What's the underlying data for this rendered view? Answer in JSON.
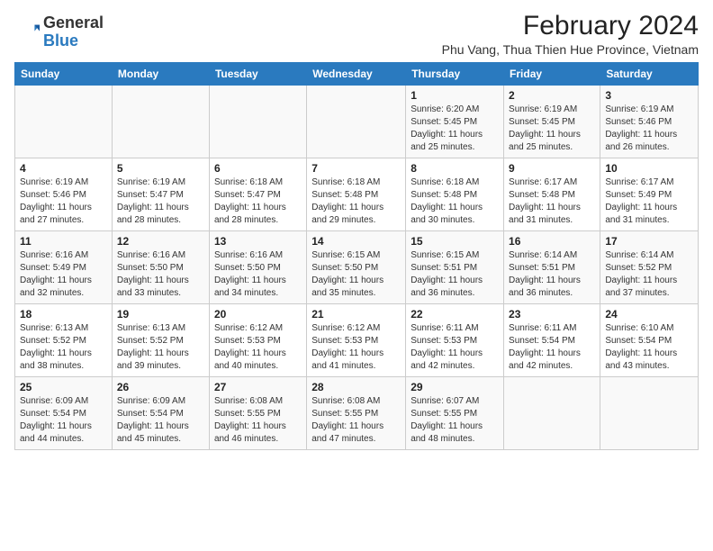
{
  "logo": {
    "general": "General",
    "blue": "Blue"
  },
  "title": "February 2024",
  "subtitle": "Phu Vang, Thua Thien Hue Province, Vietnam",
  "headers": [
    "Sunday",
    "Monday",
    "Tuesday",
    "Wednesday",
    "Thursday",
    "Friday",
    "Saturday"
  ],
  "weeks": [
    [
      {
        "date": "",
        "info": ""
      },
      {
        "date": "",
        "info": ""
      },
      {
        "date": "",
        "info": ""
      },
      {
        "date": "",
        "info": ""
      },
      {
        "date": "1",
        "info": "Sunrise: 6:20 AM\nSunset: 5:45 PM\nDaylight: 11 hours and 25 minutes."
      },
      {
        "date": "2",
        "info": "Sunrise: 6:19 AM\nSunset: 5:45 PM\nDaylight: 11 hours and 25 minutes."
      },
      {
        "date": "3",
        "info": "Sunrise: 6:19 AM\nSunset: 5:46 PM\nDaylight: 11 hours and 26 minutes."
      }
    ],
    [
      {
        "date": "4",
        "info": "Sunrise: 6:19 AM\nSunset: 5:46 PM\nDaylight: 11 hours and 27 minutes."
      },
      {
        "date": "5",
        "info": "Sunrise: 6:19 AM\nSunset: 5:47 PM\nDaylight: 11 hours and 28 minutes."
      },
      {
        "date": "6",
        "info": "Sunrise: 6:18 AM\nSunset: 5:47 PM\nDaylight: 11 hours and 28 minutes."
      },
      {
        "date": "7",
        "info": "Sunrise: 6:18 AM\nSunset: 5:48 PM\nDaylight: 11 hours and 29 minutes."
      },
      {
        "date": "8",
        "info": "Sunrise: 6:18 AM\nSunset: 5:48 PM\nDaylight: 11 hours and 30 minutes."
      },
      {
        "date": "9",
        "info": "Sunrise: 6:17 AM\nSunset: 5:48 PM\nDaylight: 11 hours and 31 minutes."
      },
      {
        "date": "10",
        "info": "Sunrise: 6:17 AM\nSunset: 5:49 PM\nDaylight: 11 hours and 31 minutes."
      }
    ],
    [
      {
        "date": "11",
        "info": "Sunrise: 6:16 AM\nSunset: 5:49 PM\nDaylight: 11 hours and 32 minutes."
      },
      {
        "date": "12",
        "info": "Sunrise: 6:16 AM\nSunset: 5:50 PM\nDaylight: 11 hours and 33 minutes."
      },
      {
        "date": "13",
        "info": "Sunrise: 6:16 AM\nSunset: 5:50 PM\nDaylight: 11 hours and 34 minutes."
      },
      {
        "date": "14",
        "info": "Sunrise: 6:15 AM\nSunset: 5:50 PM\nDaylight: 11 hours and 35 minutes."
      },
      {
        "date": "15",
        "info": "Sunrise: 6:15 AM\nSunset: 5:51 PM\nDaylight: 11 hours and 36 minutes."
      },
      {
        "date": "16",
        "info": "Sunrise: 6:14 AM\nSunset: 5:51 PM\nDaylight: 11 hours and 36 minutes."
      },
      {
        "date": "17",
        "info": "Sunrise: 6:14 AM\nSunset: 5:52 PM\nDaylight: 11 hours and 37 minutes."
      }
    ],
    [
      {
        "date": "18",
        "info": "Sunrise: 6:13 AM\nSunset: 5:52 PM\nDaylight: 11 hours and 38 minutes."
      },
      {
        "date": "19",
        "info": "Sunrise: 6:13 AM\nSunset: 5:52 PM\nDaylight: 11 hours and 39 minutes."
      },
      {
        "date": "20",
        "info": "Sunrise: 6:12 AM\nSunset: 5:53 PM\nDaylight: 11 hours and 40 minutes."
      },
      {
        "date": "21",
        "info": "Sunrise: 6:12 AM\nSunset: 5:53 PM\nDaylight: 11 hours and 41 minutes."
      },
      {
        "date": "22",
        "info": "Sunrise: 6:11 AM\nSunset: 5:53 PM\nDaylight: 11 hours and 42 minutes."
      },
      {
        "date": "23",
        "info": "Sunrise: 6:11 AM\nSunset: 5:54 PM\nDaylight: 11 hours and 42 minutes."
      },
      {
        "date": "24",
        "info": "Sunrise: 6:10 AM\nSunset: 5:54 PM\nDaylight: 11 hours and 43 minutes."
      }
    ],
    [
      {
        "date": "25",
        "info": "Sunrise: 6:09 AM\nSunset: 5:54 PM\nDaylight: 11 hours and 44 minutes."
      },
      {
        "date": "26",
        "info": "Sunrise: 6:09 AM\nSunset: 5:54 PM\nDaylight: 11 hours and 45 minutes."
      },
      {
        "date": "27",
        "info": "Sunrise: 6:08 AM\nSunset: 5:55 PM\nDaylight: 11 hours and 46 minutes."
      },
      {
        "date": "28",
        "info": "Sunrise: 6:08 AM\nSunset: 5:55 PM\nDaylight: 11 hours and 47 minutes."
      },
      {
        "date": "29",
        "info": "Sunrise: 6:07 AM\nSunset: 5:55 PM\nDaylight: 11 hours and 48 minutes."
      },
      {
        "date": "",
        "info": ""
      },
      {
        "date": "",
        "info": ""
      }
    ]
  ]
}
